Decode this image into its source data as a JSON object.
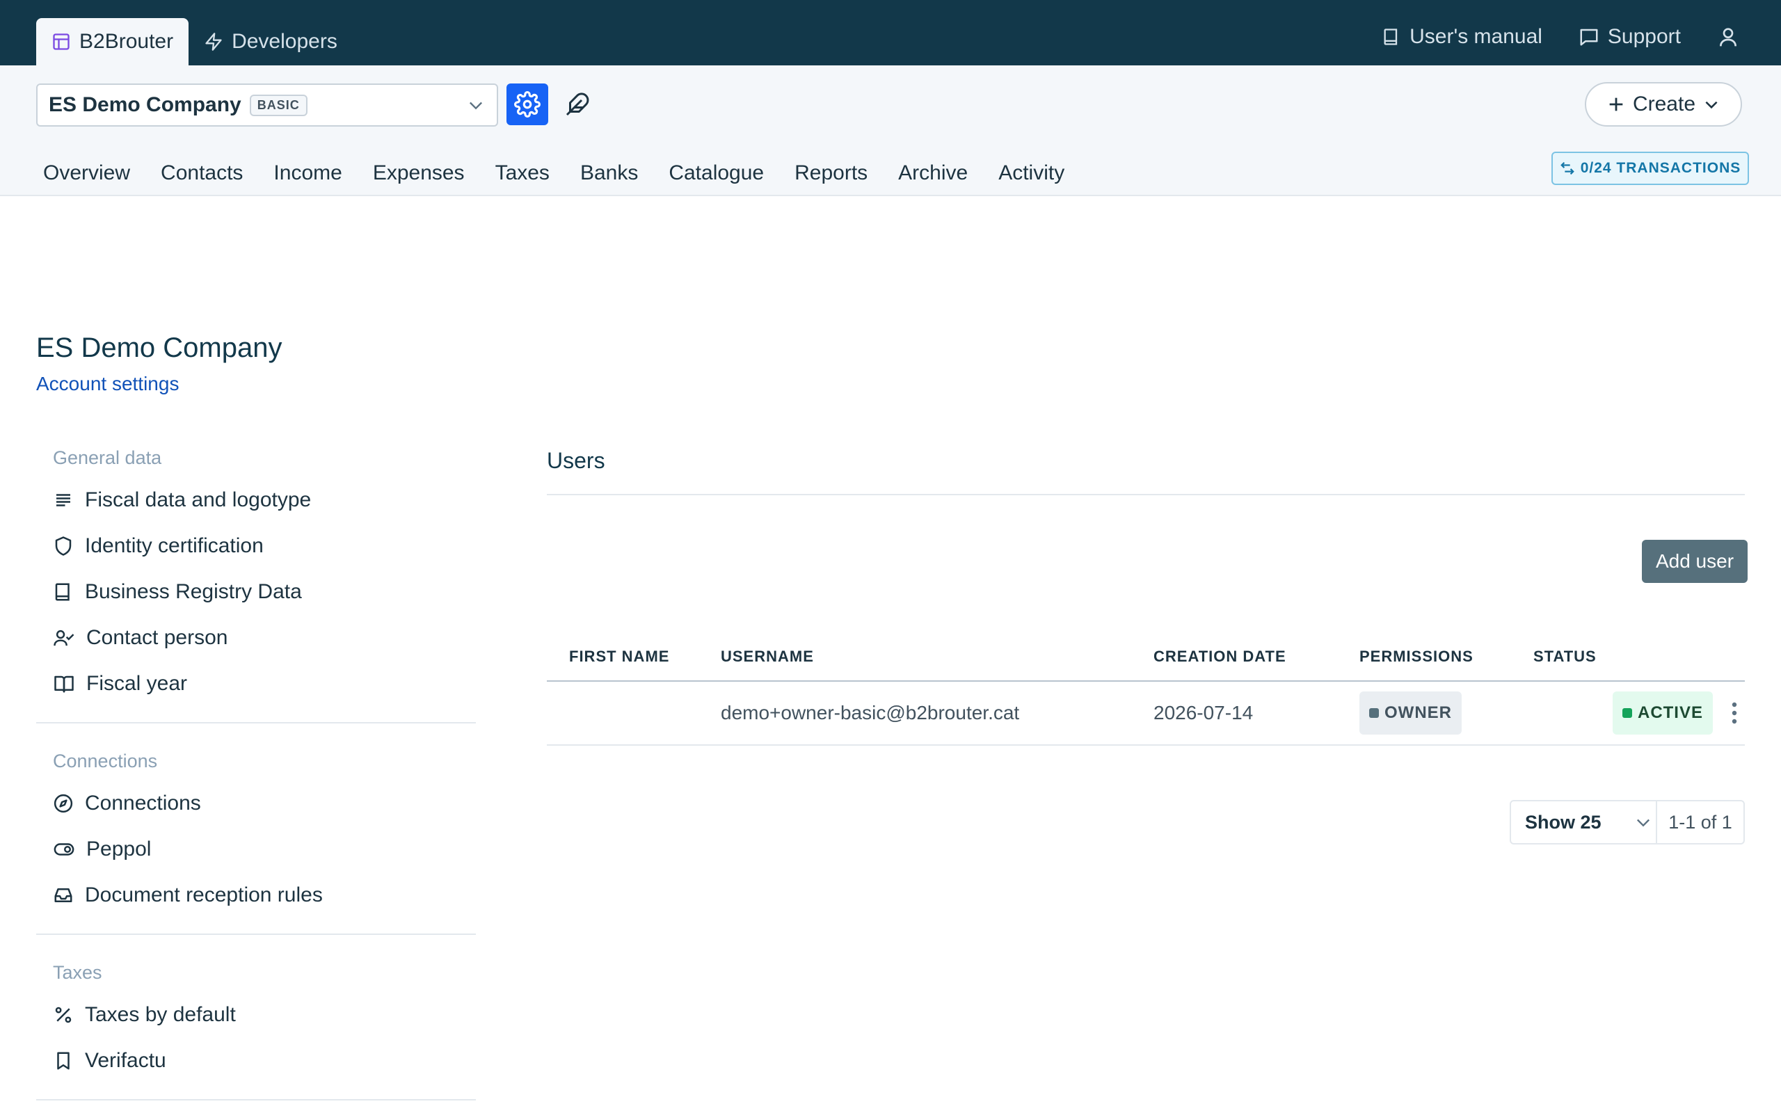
{
  "topbar": {
    "tabs": [
      {
        "label": "B2Brouter",
        "icon": "layout-icon"
      },
      {
        "label": "Developers",
        "icon": "lightning-icon"
      }
    ],
    "links": [
      {
        "label": "User's manual",
        "icon": "book-icon"
      },
      {
        "label": "Support",
        "icon": "chat-icon"
      }
    ],
    "user_icon": "user-icon",
    "colors": {
      "background": "#12384a"
    }
  },
  "company_selector": {
    "name": "ES Demo Company",
    "plan": "BASIC"
  },
  "create_button": {
    "label": "Create"
  },
  "main_nav": [
    "Overview",
    "Contacts",
    "Income",
    "Expenses",
    "Taxes",
    "Banks",
    "Catalogue",
    "Reports",
    "Archive",
    "Activity"
  ],
  "transactions_badge": "0/24 TRANSACTIONS",
  "page": {
    "title": "ES Demo Company",
    "subtitle": "Account settings"
  },
  "sidebar": {
    "sections": [
      {
        "heading": "General data",
        "items": [
          {
            "label": "Fiscal data and logotype",
            "icon": "lines-icon"
          },
          {
            "label": "Identity certification",
            "icon": "shield-icon"
          },
          {
            "label": "Business Registry Data",
            "icon": "book-icon"
          },
          {
            "label": "Contact person",
            "icon": "user-check-icon"
          },
          {
            "label": "Fiscal year",
            "icon": "open-book-icon"
          }
        ]
      },
      {
        "heading": "Connections",
        "items": [
          {
            "label": "Connections",
            "icon": "compass-icon"
          },
          {
            "label": "Peppol",
            "icon": "toggle-icon"
          },
          {
            "label": "Document reception rules",
            "icon": "inbox-icon"
          }
        ]
      },
      {
        "heading": "Taxes",
        "items": [
          {
            "label": "Taxes by default",
            "icon": "percent-icon"
          },
          {
            "label": "Verifactu",
            "icon": "bookmark-icon"
          }
        ]
      }
    ]
  },
  "users_panel": {
    "title": "Users",
    "add_user_label": "Add user",
    "columns": [
      "FIRST NAME",
      "USERNAME",
      "CREATION DATE",
      "PERMISSIONS",
      "STATUS"
    ],
    "rows": [
      {
        "first_name": "",
        "username": "demo+owner-basic@b2brouter.cat",
        "creation_date": "2026-07-14",
        "permissions": "OWNER",
        "status": "ACTIVE"
      }
    ],
    "pager": {
      "show": "Show 25",
      "range": "1-1 of 1"
    }
  },
  "colors": {
    "accent": "#1763f5",
    "link": "#1152b8",
    "active_status": "#14a35a",
    "owner_status": "#56707c"
  }
}
